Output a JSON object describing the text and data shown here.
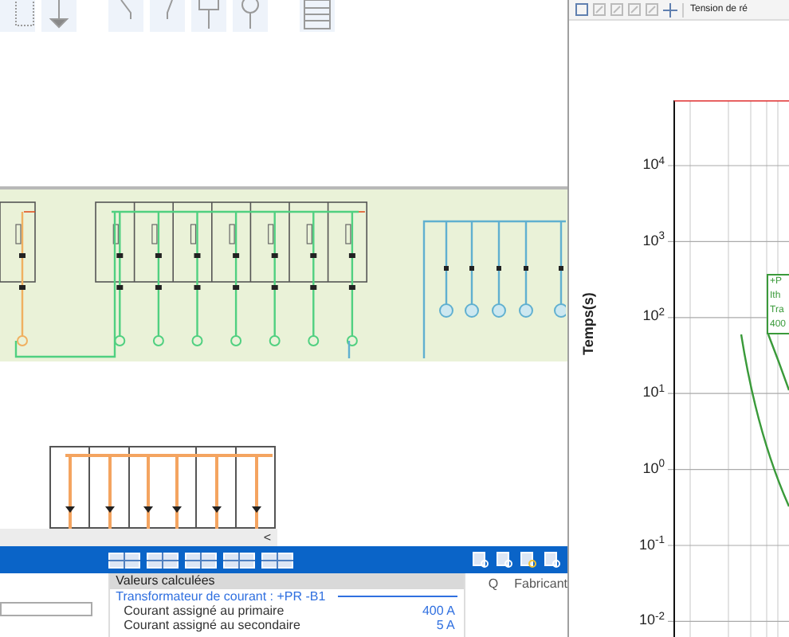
{
  "schematic": {
    "scroll_button": "<"
  },
  "calculated_values": {
    "header": "Valeurs calculées",
    "group": "Transformateur de courant : +PR -B1",
    "rows": [
      {
        "label": "Courant assigné au primaire",
        "value": "400 A"
      },
      {
        "label": "Courant assigné au secondaire",
        "value": "5 A"
      }
    ]
  },
  "parts_columns": [
    "Q",
    "Fabricant"
  ],
  "curve_toolbar": {
    "label": "Tension de ré"
  },
  "curve_chart": {
    "ylabel": "Temps(s)",
    "yticks": [
      "10$^{4}$",
      "10$^{3}$",
      "10$^{2}$",
      "10$^{1}$",
      "10$^{0}$",
      "10$^{-1}$",
      "10$^{-2}$"
    ],
    "legend": [
      "+P",
      "Ith",
      "Tra",
      "400"
    ]
  }
}
